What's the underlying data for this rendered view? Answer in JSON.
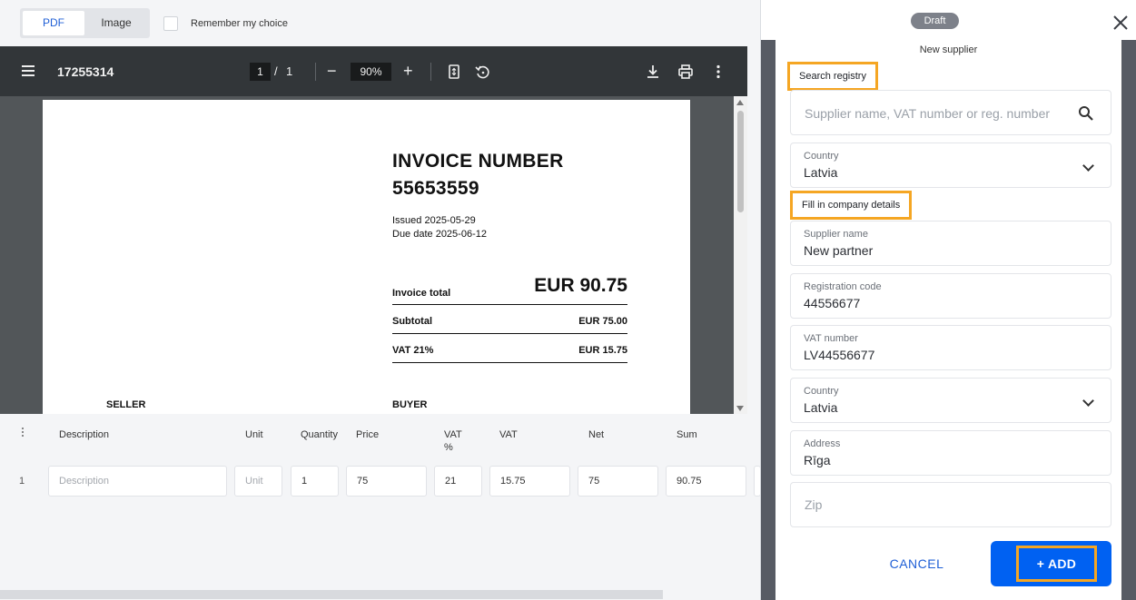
{
  "toggle": {
    "pdf_label": "PDF",
    "image_label": "Image",
    "remember_label": "Remember my choice"
  },
  "viewer": {
    "filename": "17255314",
    "page_current": "1",
    "page_separator": "/",
    "page_total": "1",
    "zoom": "90%",
    "zoom_out": "−",
    "zoom_in": "+"
  },
  "invoice": {
    "title_line1": "INVOICE NUMBER",
    "title_line2": "55653559",
    "issued": "Issued 2025-05-29",
    "due": "Due date 2025-06-12",
    "total_label": "Invoice total",
    "total_value": "EUR 90.75",
    "subtotal_label": "Subtotal",
    "subtotal_value": "EUR 75.00",
    "vat_label": "VAT 21%",
    "vat_value": "EUR 15.75",
    "seller_label": "SELLER",
    "buyer_label": "BUYER"
  },
  "items": {
    "headers": {
      "description": "Description",
      "unit": "Unit",
      "quantity": "Quantity",
      "price": "Price",
      "vat_pct_1": "VAT",
      "vat_pct_2": "%",
      "vat": "VAT",
      "net": "Net",
      "sum": "Sum"
    },
    "rows": [
      {
        "num": "1",
        "description_placeholder": "Description",
        "unit_placeholder": "Unit",
        "quantity": "1",
        "price": "75",
        "vat_pct": "21",
        "vat": "15.75",
        "net": "75",
        "sum": "90.75"
      }
    ]
  },
  "panel": {
    "status": "Draft",
    "title": "New supplier",
    "search_section": "Search registry",
    "search_placeholder": "Supplier name, VAT number or reg. number",
    "country1_label": "Country",
    "country1_value": "Latvia",
    "details_section": "Fill in company details",
    "supplier_name_label": "Supplier name",
    "supplier_name_value": "New partner",
    "reg_code_label": "Registration code",
    "reg_code_value": "44556677",
    "vat_number_label": "VAT number",
    "vat_number_value": "LV44556677",
    "country2_label": "Country",
    "country2_value": "Latvia",
    "address_label": "Address",
    "address_value": "Rīga",
    "zip_placeholder": "Zip",
    "cancel_label": "CANCEL",
    "add_label": "+ ADD"
  },
  "colors": {
    "accent": "#0061f2",
    "highlight": "#f5a623",
    "draft_badge": "#7d818a"
  }
}
